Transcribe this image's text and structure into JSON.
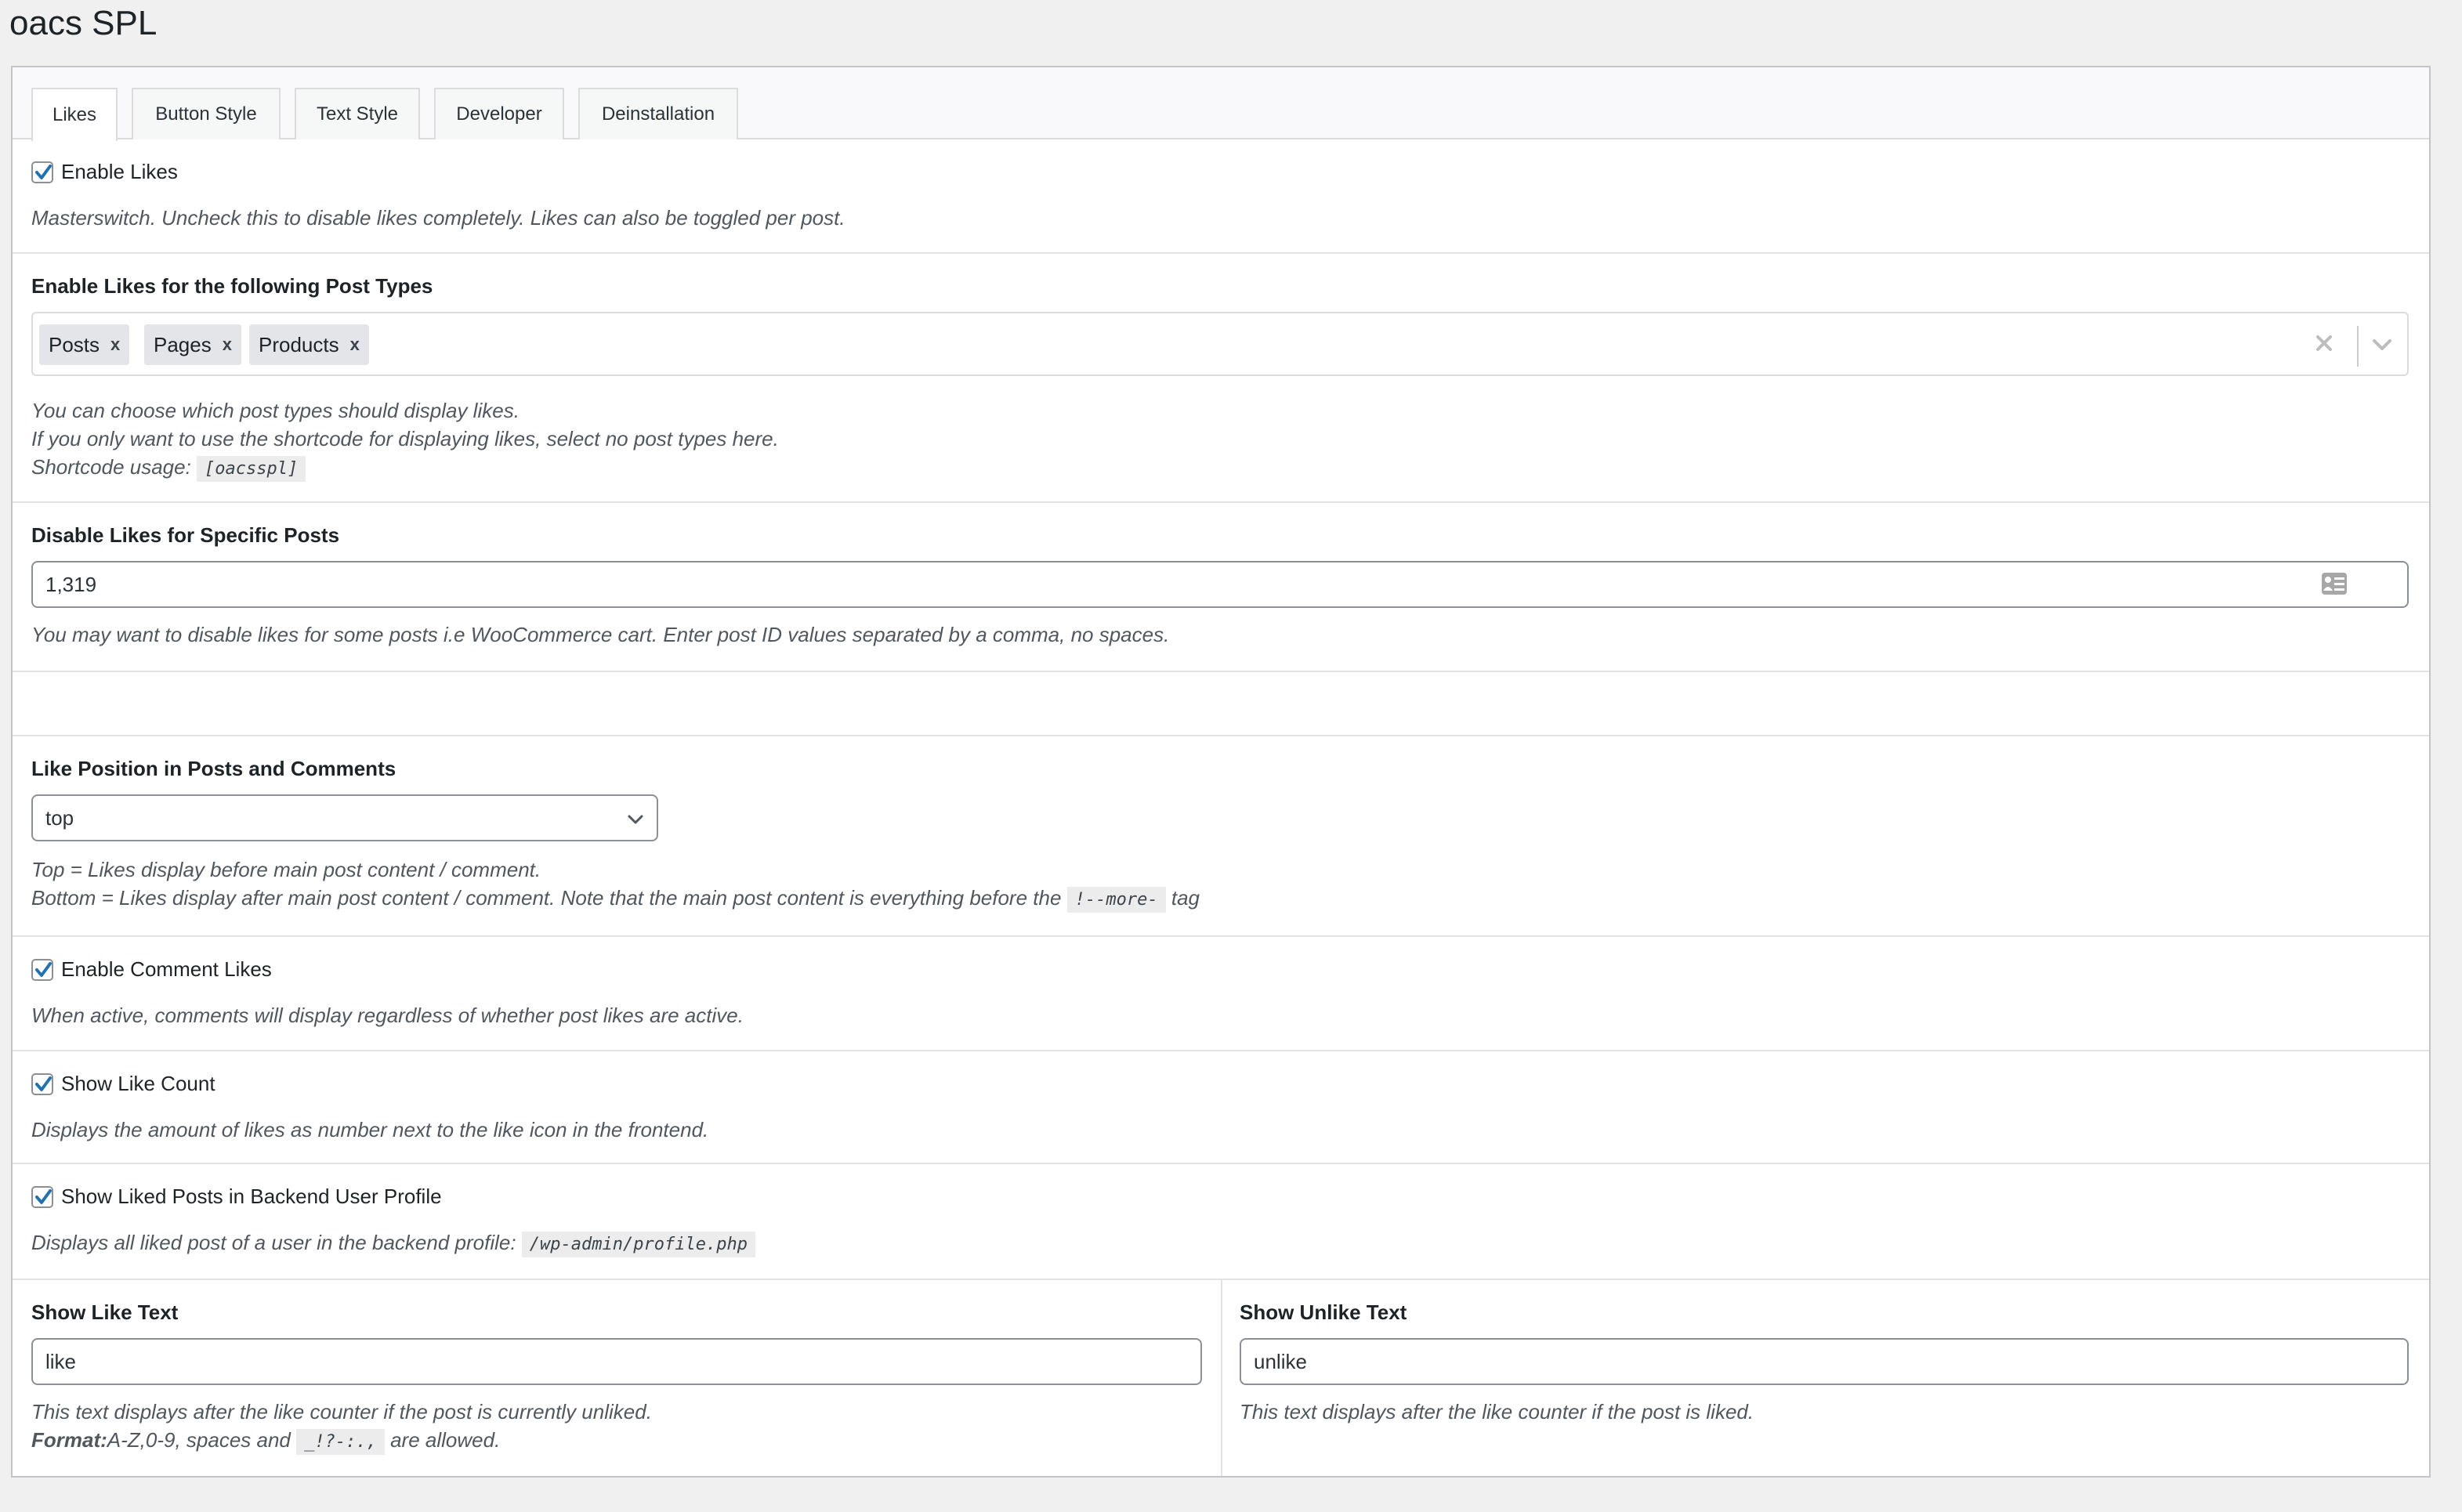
{
  "page": {
    "title": "oacs SPL"
  },
  "tabs": [
    {
      "label": "Likes",
      "active": true
    },
    {
      "label": "Button Style",
      "active": false
    },
    {
      "label": "Text Style",
      "active": false
    },
    {
      "label": "Developer",
      "active": false
    },
    {
      "label": "Deinstallation",
      "active": false
    }
  ],
  "enable_likes": {
    "label": "Enable Likes",
    "checked": true,
    "description": "Masterswitch. Uncheck this to disable likes completely. Likes can also be toggled per post."
  },
  "post_types": {
    "label": "Enable Likes for the following Post Types",
    "selected": [
      "Posts",
      "Pages",
      "Products"
    ],
    "remove_glyph": "x",
    "description_lines": [
      "You can choose which post types should display likes.",
      "If you only want to use the shortcode for displaying likes, select no post types here."
    ],
    "shortcode_label": "Shortcode usage:",
    "shortcode": "[oacsspl]"
  },
  "disable_specific": {
    "label": "Disable Likes for Specific Posts",
    "value": "1,319",
    "description": "You may want to disable likes for some posts i.e WooCommerce cart. Enter post ID values separated by a comma, no spaces."
  },
  "like_position": {
    "label": "Like Position in Posts and Comments",
    "selected": "top",
    "description_top": "Top = Likes display before main post content / comment.",
    "description_bottom_prefix": "Bottom = Likes display after main post content / comment. Note that the main post content is everything before the",
    "description_bottom_code": "!--more-",
    "description_bottom_suffix": "tag"
  },
  "comment_likes": {
    "label": "Enable Comment Likes",
    "checked": true,
    "description": "When active, comments will display regardless of whether post likes are active."
  },
  "like_count": {
    "label": "Show Like Count",
    "checked": true,
    "description": "Displays the amount of likes as number next to the like icon in the frontend."
  },
  "liked_posts_profile": {
    "label": "Show Liked Posts in Backend User Profile",
    "checked": true,
    "description_prefix": "Displays all liked post of a user in the backend profile:",
    "description_code": "/wp-admin/profile.php"
  },
  "like_text": {
    "label": "Show Like Text",
    "value": "like",
    "description": "This text displays after the like counter if the post is currently unliked.",
    "format_label": "Format:",
    "format_text": "A-Z,0-9, spaces and",
    "format_code": "_!?-:.,",
    "format_suffix": "are allowed."
  },
  "unlike_text": {
    "label": "Show Unlike Text",
    "value": "unlike",
    "description": "This text displays after the like counter if the post is liked."
  },
  "colors": {
    "accent_check": "#2271b1",
    "background": "#f0f0f1",
    "panel_border": "#c3c4c7"
  }
}
